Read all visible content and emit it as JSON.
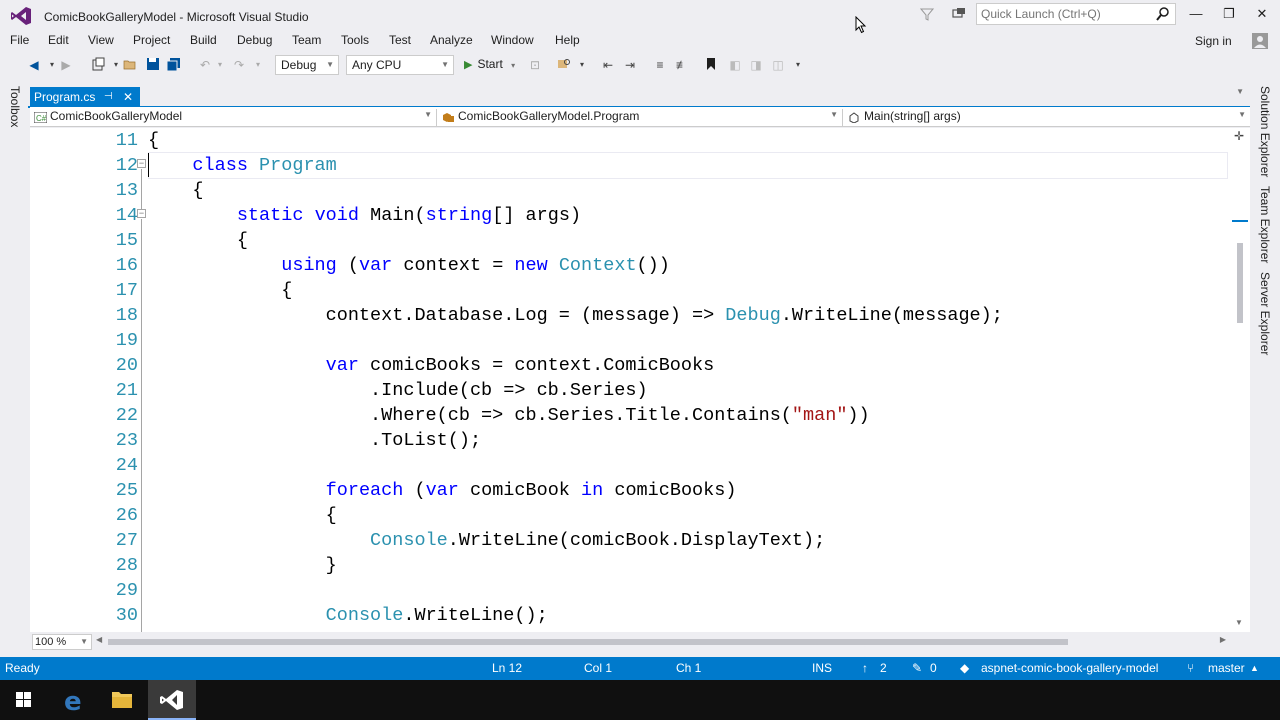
{
  "window": {
    "title": "ComicBookGalleryModel - Microsoft Visual Studio",
    "quick_launch_placeholder": "Quick Launch (Ctrl+Q)",
    "sign_in": "Sign in"
  },
  "menu": [
    "File",
    "Edit",
    "View",
    "Project",
    "Build",
    "Debug",
    "Team",
    "Tools",
    "Test",
    "Analyze",
    "Window",
    "Help"
  ],
  "toolbar": {
    "config": "Debug",
    "platform": "Any CPU",
    "start": "Start"
  },
  "toolbox_label": "Toolbox",
  "tab": {
    "name": "Program.cs"
  },
  "navbar": {
    "project": "ComicBookGalleryModel",
    "class": "ComicBookGalleryModel.Program",
    "member": "Main(string[] args)"
  },
  "code_lines": [
    {
      "n": "11",
      "code": [
        {
          "t": "{",
          "c": ""
        }
      ]
    },
    {
      "n": "12",
      "code": [
        {
          "t": "    ",
          "c": ""
        },
        {
          "t": "class",
          "c": "kw"
        },
        {
          "t": " ",
          "c": ""
        },
        {
          "t": "Program",
          "c": "ty"
        }
      ]
    },
    {
      "n": "13",
      "code": [
        {
          "t": "    {",
          "c": ""
        }
      ]
    },
    {
      "n": "14",
      "code": [
        {
          "t": "        ",
          "c": ""
        },
        {
          "t": "static",
          "c": "kw"
        },
        {
          "t": " ",
          "c": ""
        },
        {
          "t": "void",
          "c": "kw"
        },
        {
          "t": " Main(",
          "c": ""
        },
        {
          "t": "string",
          "c": "kw"
        },
        {
          "t": "[] args)",
          "c": ""
        }
      ]
    },
    {
      "n": "15",
      "code": [
        {
          "t": "        {",
          "c": ""
        }
      ]
    },
    {
      "n": "16",
      "code": [
        {
          "t": "            ",
          "c": ""
        },
        {
          "t": "using",
          "c": "kw"
        },
        {
          "t": " (",
          "c": ""
        },
        {
          "t": "var",
          "c": "kw"
        },
        {
          "t": " context = ",
          "c": ""
        },
        {
          "t": "new",
          "c": "kw"
        },
        {
          "t": " ",
          "c": ""
        },
        {
          "t": "Context",
          "c": "ty"
        },
        {
          "t": "())",
          "c": ""
        }
      ]
    },
    {
      "n": "17",
      "code": [
        {
          "t": "            {",
          "c": ""
        }
      ]
    },
    {
      "n": "18",
      "code": [
        {
          "t": "                context.Database.Log = (message) => ",
          "c": ""
        },
        {
          "t": "Debug",
          "c": "ty"
        },
        {
          "t": ".WriteLine(message);",
          "c": ""
        }
      ]
    },
    {
      "n": "19",
      "code": [
        {
          "t": "",
          "c": ""
        }
      ]
    },
    {
      "n": "20",
      "code": [
        {
          "t": "                ",
          "c": ""
        },
        {
          "t": "var",
          "c": "kw"
        },
        {
          "t": " comicBooks = context.ComicBooks",
          "c": ""
        }
      ]
    },
    {
      "n": "21",
      "code": [
        {
          "t": "                    .Include(cb => cb.Series)",
          "c": ""
        }
      ]
    },
    {
      "n": "22",
      "code": [
        {
          "t": "                    .Where(cb => cb.Series.Title.Contains(",
          "c": ""
        },
        {
          "t": "\"man\"",
          "c": "str"
        },
        {
          "t": "))",
          "c": ""
        }
      ]
    },
    {
      "n": "23",
      "code": [
        {
          "t": "                    .ToList();",
          "c": ""
        }
      ]
    },
    {
      "n": "24",
      "code": [
        {
          "t": "",
          "c": ""
        }
      ]
    },
    {
      "n": "25",
      "code": [
        {
          "t": "                ",
          "c": ""
        },
        {
          "t": "foreach",
          "c": "kw"
        },
        {
          "t": " (",
          "c": ""
        },
        {
          "t": "var",
          "c": "kw"
        },
        {
          "t": " comicBook ",
          "c": ""
        },
        {
          "t": "in",
          "c": "kw"
        },
        {
          "t": " comicBooks)",
          "c": ""
        }
      ]
    },
    {
      "n": "26",
      "code": [
        {
          "t": "                {",
          "c": ""
        }
      ]
    },
    {
      "n": "27",
      "code": [
        {
          "t": "                    ",
          "c": ""
        },
        {
          "t": "Console",
          "c": "ty"
        },
        {
          "t": ".WriteLine(comicBook.DisplayText);",
          "c": ""
        }
      ]
    },
    {
      "n": "28",
      "code": [
        {
          "t": "                }",
          "c": ""
        }
      ]
    },
    {
      "n": "29",
      "code": [
        {
          "t": "",
          "c": ""
        }
      ]
    },
    {
      "n": "30",
      "code": [
        {
          "t": "                ",
          "c": ""
        },
        {
          "t": "Console",
          "c": "ty"
        },
        {
          "t": ".WriteLine();",
          "c": ""
        }
      ]
    }
  ],
  "editor": {
    "zoom": "100 %"
  },
  "right_panels": [
    "Solution Explorer",
    "Team Explorer",
    "Server Explorer"
  ],
  "status": {
    "state": "Ready",
    "line": "Ln 12",
    "col": "Col 1",
    "ch": "Ch 1",
    "mode": "INS",
    "unpublished": "2",
    "pending": "0",
    "repo": "aspnet-comic-book-gallery-model",
    "branch": "master"
  },
  "colors": {
    "accent": "#007acc",
    "keyword": "#0000ff",
    "type": "#2b91af",
    "string": "#a31515"
  }
}
